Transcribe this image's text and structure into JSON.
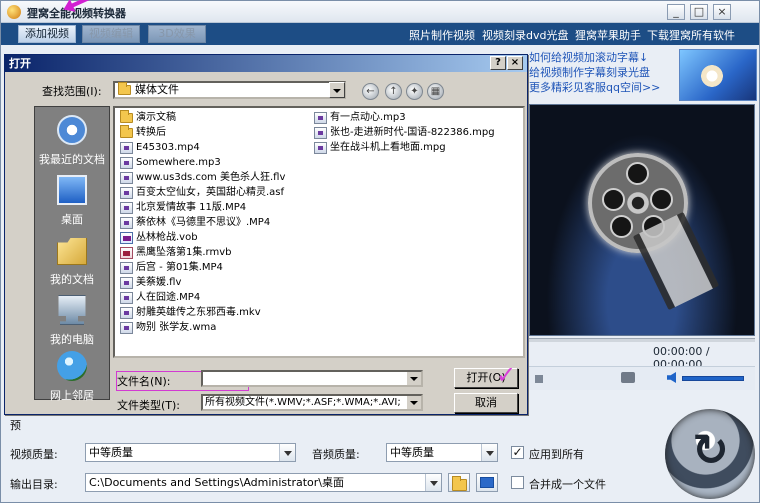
{
  "app": {
    "title": "狸窝全能视频转换器",
    "win_controls": [
      "_",
      "□",
      "×"
    ],
    "toolbar": {
      "add_video": "添加视频",
      "video_edit": "视频编辑",
      "effect_3d": "3D效果",
      "links": [
        "照片制作视频",
        "视频刻录dvd光盘",
        "狸窝苹果助手",
        "下载狸窝所有软件"
      ]
    },
    "side_links": [
      "如何给视频加滚动字幕↓",
      "给视频制作字幕刻录光盘",
      "更多精彩见客服qq空间>>"
    ],
    "time": "00:00:00 / 00:00:00",
    "settings": {
      "video_quality_label": "视频质量:",
      "video_quality_value": "中等质量",
      "audio_quality_label": "音频质量:",
      "audio_quality_value": "中等质量",
      "apply_all_label": "应用到所有",
      "apply_all_checked": "✓",
      "output_label": "输出目录:",
      "output_path": "C:\\Documents and Settings\\Administrator\\桌面",
      "merge_label": "合并成一个文件",
      "partial_label": "预"
    }
  },
  "dialog": {
    "title": "打开",
    "title_buttons": [
      "?",
      "×"
    ],
    "lookin_label": "查找范围(I):",
    "lookin_value": "媒体文件",
    "nav": [
      "←",
      "↑",
      "✦",
      "▦"
    ],
    "places": [
      "我最近的文档",
      "桌面",
      "我的文档",
      "我的电脑",
      "网上邻居"
    ],
    "files_col1": [
      {
        "name": "演示文稿",
        "type": "folder"
      },
      {
        "name": "转换后",
        "type": "folder"
      },
      {
        "name": "E45303.mp4",
        "type": "media"
      },
      {
        "name": "Somewhere.mp3",
        "type": "media"
      },
      {
        "name": "www.us3ds.com 美色杀人狂.flv",
        "type": "media"
      },
      {
        "name": "百变太空仙女，英国甜心精灵.asf",
        "type": "media"
      },
      {
        "name": "北京爱情故事 11版.MP4",
        "type": "media"
      },
      {
        "name": "蔡依林《马德里不思议》.MP4",
        "type": "media"
      },
      {
        "name": "丛林枪战.vob",
        "type": "vob"
      },
      {
        "name": "黑鹰坠落第1集.rmvb",
        "type": "rm"
      },
      {
        "name": "后宫 - 第01集.MP4",
        "type": "media"
      },
      {
        "name": "美蔡媛.flv",
        "type": "media"
      },
      {
        "name": "人在囧途.MP4",
        "type": "media"
      },
      {
        "name": "射雕英雄传之东邪西毒.mkv",
        "type": "media"
      },
      {
        "name": "吻别 张学友.wma",
        "type": "media"
      }
    ],
    "files_col2": [
      {
        "name": "有一点动心.mp3",
        "type": "media"
      },
      {
        "name": "张也-走进新时代-国语-822386.mpg",
        "type": "media"
      },
      {
        "name": "坐在战斗机上看地面.mpg",
        "type": "media"
      }
    ],
    "filename_label": "文件名(N):",
    "filename_value": "",
    "filetype_label": "文件类型(T):",
    "filetype_value": "所有视频文件(*.WMV;*.ASF;*.WMA;*.AVI;",
    "open_button": "打开(O)",
    "cancel_button": "取消",
    "open_check": "✓"
  }
}
